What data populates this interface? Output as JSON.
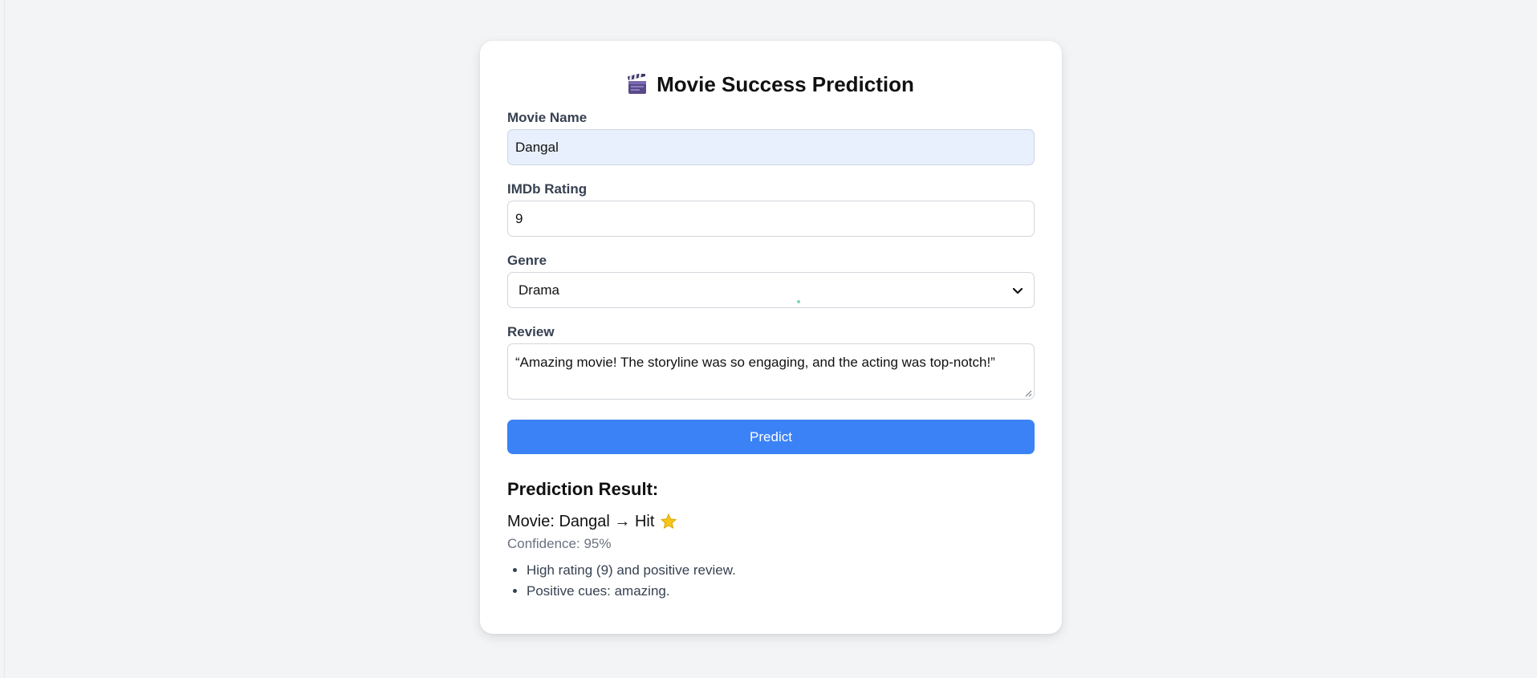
{
  "form": {
    "title": "Movie Success Prediction",
    "title_icon": "clapperboard-icon",
    "movie_name": {
      "label": "Movie Name",
      "value": "Dangal"
    },
    "imdb_rating": {
      "label": "IMDb Rating",
      "value": "9"
    },
    "genre": {
      "label": "Genre",
      "value": "Drama"
    },
    "review": {
      "label": "Review",
      "value": "“Amazing movie! The storyline was so engaging, and the acting was top-notch!”"
    },
    "predict_label": "Predict"
  },
  "result": {
    "heading": "Prediction Result:",
    "summary": "Movie: Dangal → Hit",
    "summary_icon": "star-icon",
    "confidence": "Confidence: 95%",
    "reasons": [
      "High rating (9) and positive review.",
      "Positive cues: amazing."
    ]
  },
  "colors": {
    "accent": "#3b82f6",
    "autofill_bg": "#e8f0fe",
    "page_bg": "#f3f4f6"
  }
}
